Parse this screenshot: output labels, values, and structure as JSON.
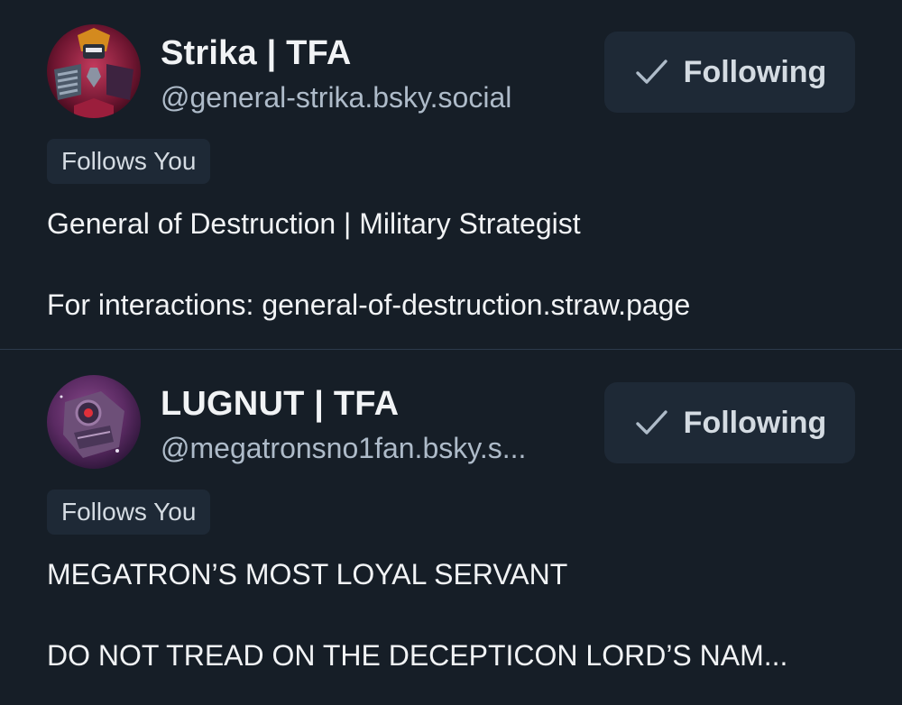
{
  "follow_list": [
    {
      "display_name": "Strika | TFA",
      "handle": "@general-strika.bsky.social",
      "follow_button_label": "Following",
      "follows_you_badge": "Follows You",
      "bio_lines": [
        "General of Destruction | Military Strategist",
        "For interactions: general-of-destruction.straw.page"
      ],
      "avatar_icon": "decepticon-portrait",
      "follow_icon": "checkmark-icon"
    },
    {
      "display_name": "LUGNUT | TFA",
      "handle": "@megatronsno1fan.bsky.s...",
      "follow_button_label": "Following",
      "follows_you_badge": "Follows You",
      "bio_lines": [
        "MEGATRON’S MOST LOYAL SERVANT",
        "DO NOT TREAD ON THE DECEPTICON LORD’S NAM..."
      ],
      "avatar_icon": "decepticon-portrait",
      "follow_icon": "checkmark-icon"
    }
  ],
  "colors": {
    "background": "#161e27",
    "button_bg": "#1e2936",
    "text_primary": "#f1f3f5",
    "text_secondary": "#aebbc9",
    "divider": "#2c3a4b"
  }
}
